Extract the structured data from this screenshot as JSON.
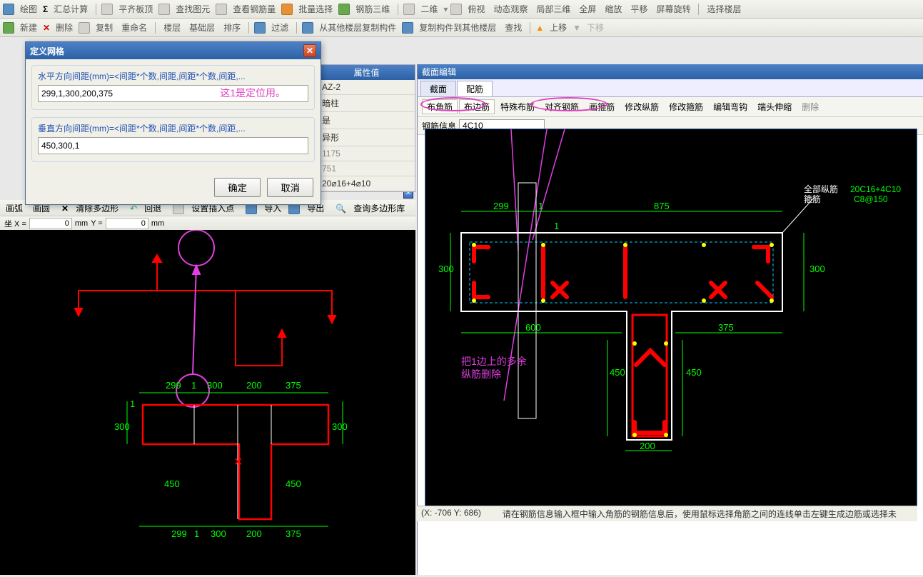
{
  "toolbars": {
    "row1": [
      "绘图",
      "汇总计算",
      "平齐板顶",
      "查找图元",
      "查看钢筋量",
      "批量选择",
      "钢筋三维",
      "二维",
      "俯视",
      "动态观察",
      "局部三维",
      "全屏",
      "缩放",
      "平移",
      "屏幕旋转",
      "选择楼层"
    ],
    "row2": [
      "新建",
      "删除",
      "复制",
      "重命名",
      "楼层",
      "基础层",
      "排序",
      "过滤",
      "从其他楼层复制构件",
      "复制构件到其他楼层",
      "查找",
      "上移",
      "下移"
    ]
  },
  "dialog": {
    "title": "定义网格",
    "h_label": "水平方向间距(mm)=<间距*个数,间距,间距*个数,间距,...",
    "h_value": "299,1,300,200,375",
    "note": "这1是定位用。",
    "v_label": "垂直方向间距(mm)=<间距*个数,间距,间距*个数,间距,...",
    "v_value": "450,300,1",
    "ok": "确定",
    "cancel": "取消"
  },
  "sub_toolbar": {
    "items": [
      "画弧",
      "画圆",
      "清除多边形",
      "回退",
      "设置插入点",
      "导入",
      "导出",
      "查询多边形库"
    ]
  },
  "coord": {
    "label_x": "坐  X = ",
    "val_x": "0",
    "unit": "mm",
    "label_y": "Y = ",
    "val_y": "0"
  },
  "prop": {
    "header": "属性值",
    "rows": [
      "AZ-2",
      "暗柱",
      "是",
      "异形",
      "1175",
      "751",
      "20⌀16+4⌀10"
    ]
  },
  "section": {
    "title": "截面编辑",
    "tabs": [
      "截面",
      "配筋"
    ],
    "active_tab": 1,
    "rebar_buttons": [
      "布角筋",
      "布边筋",
      "特殊布筋",
      "对齐钢筋",
      "画箍筋",
      "修改纵筋",
      "修改箍筋",
      "编辑弯钩",
      "端头伸缩",
      "删除"
    ],
    "rebar_info_label": "钢筋信息",
    "rebar_info_value": "4C10"
  },
  "left_dims": {
    "top": [
      "299",
      "1",
      "300",
      "200",
      "375"
    ],
    "left_300": "300",
    "right_300": "300",
    "left_450": "450",
    "right_450": "450",
    "left_tick": "1",
    "bottom": [
      "299",
      "1",
      "300",
      "200",
      "375"
    ]
  },
  "right_dims": {
    "top_299": "299",
    "top_1": "1",
    "top_875": "875",
    "mid_1": "1",
    "left_300": "300",
    "right_300": "300",
    "bot_600": "600",
    "bot_375": "375",
    "left_450": "450",
    "right_450": "450",
    "bot_200": "200"
  },
  "annotations": {
    "right_note": "把1边上的多余\n纵筋删除",
    "legend_title": "全部纵筋",
    "legend_l1": "20C16+4C10",
    "legend_stirrup": "箍筋",
    "legend_l2": "C8@150"
  },
  "status": {
    "coord": "(X: -706 Y: 686)",
    "hint": "请在钢筋信息输入框中输入角筋的钢筋信息后，使用鼠标选择角筋之间的连线单击左键生成边筋或选择未"
  },
  "chart_data": {
    "type": "section-geometry",
    "h_spacing_mm": [
      299,
      1,
      300,
      200,
      375
    ],
    "v_spacing_mm": [
      450,
      300,
      1
    ],
    "rebar": {
      "longitudinal": "20C16+4C10",
      "stirrup": "C8@150",
      "info": "4C10"
    }
  }
}
